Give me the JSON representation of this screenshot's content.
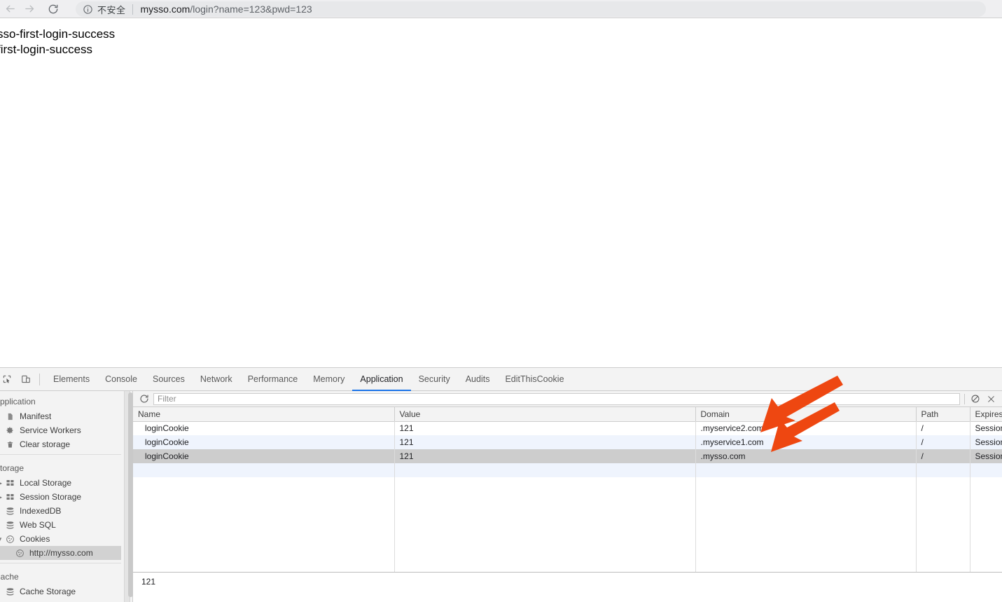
{
  "browser": {
    "nav": {
      "back_icon": "arrow-left-icon",
      "forward_icon": "arrow-right-icon",
      "reload_icon": "reload-icon"
    },
    "omnibox": {
      "info_icon": "info-circle-icon",
      "security_text": "不安全",
      "url_host": "mysso.com",
      "url_path": "/login?name=123&pwd=123"
    }
  },
  "page": {
    "line1": "sso-first-login-success",
    "line2": "first-login-success"
  },
  "devtools": {
    "left_icons": [
      {
        "name": "inspect-element-icon"
      },
      {
        "name": "device-toolbar-icon"
      }
    ],
    "tabs": [
      {
        "label": "Elements",
        "active": false
      },
      {
        "label": "Console",
        "active": false
      },
      {
        "label": "Sources",
        "active": false
      },
      {
        "label": "Network",
        "active": false
      },
      {
        "label": "Performance",
        "active": false
      },
      {
        "label": "Memory",
        "active": false
      },
      {
        "label": "Application",
        "active": true
      },
      {
        "label": "Security",
        "active": false
      },
      {
        "label": "Audits",
        "active": false
      },
      {
        "label": "EditThisCookie",
        "active": false
      }
    ],
    "sidebar": {
      "sections": [
        {
          "title": "Application",
          "items": [
            {
              "label": "Manifest",
              "icon": "document-icon",
              "expandable": false,
              "selected": false
            },
            {
              "label": "Service Workers",
              "icon": "gear-icon",
              "expandable": false,
              "selected": false
            },
            {
              "label": "Clear storage",
              "icon": "trash-icon",
              "expandable": false,
              "selected": false
            }
          ]
        },
        {
          "title": "Storage",
          "items": [
            {
              "label": "Local Storage",
              "icon": "storage-icon",
              "expandable": true,
              "expanded": false,
              "selected": false
            },
            {
              "label": "Session Storage",
              "icon": "storage-icon",
              "expandable": true,
              "expanded": false,
              "selected": false
            },
            {
              "label": "IndexedDB",
              "icon": "database-icon",
              "expandable": false,
              "selected": false
            },
            {
              "label": "Web SQL",
              "icon": "database-icon",
              "expandable": false,
              "selected": false
            },
            {
              "label": "Cookies",
              "icon": "cookie-icon",
              "expandable": true,
              "expanded": true,
              "selected": false
            },
            {
              "label": "http://mysso.com",
              "icon": "cookie-icon",
              "expandable": false,
              "selected": true,
              "child": true
            }
          ]
        },
        {
          "title": "Cache",
          "items": [
            {
              "label": "Cache Storage",
              "icon": "database-icon",
              "expandable": false,
              "selected": false
            }
          ]
        }
      ]
    },
    "filter_bar": {
      "refresh_icon": "refresh-icon",
      "placeholder": "Filter",
      "value": "",
      "clear_all_icon": "block-icon",
      "close_icon": "close-icon"
    },
    "cookie_table": {
      "columns": [
        "Name",
        "Value",
        "Domain",
        "Path",
        "Expires"
      ],
      "rows": [
        {
          "name": "loginCookie",
          "value": "121",
          "domain": ".myservice2.com",
          "path": "/",
          "expires": "Session",
          "state": "even"
        },
        {
          "name": "loginCookie",
          "value": "121",
          "domain": ".myservice1.com",
          "path": "/",
          "expires": "Session",
          "state": "odd"
        },
        {
          "name": "loginCookie",
          "value": "121",
          "domain": ".mysso.com",
          "path": "/",
          "expires": "Session",
          "state": "selected"
        }
      ]
    },
    "preview": {
      "value": "121"
    }
  },
  "annotations": {
    "arrow_color": "#ee4711",
    "arrows": [
      {
        "name": "arrow-pointing-myservice2-domain"
      },
      {
        "name": "arrow-pointing-myservice1-domain"
      }
    ]
  }
}
